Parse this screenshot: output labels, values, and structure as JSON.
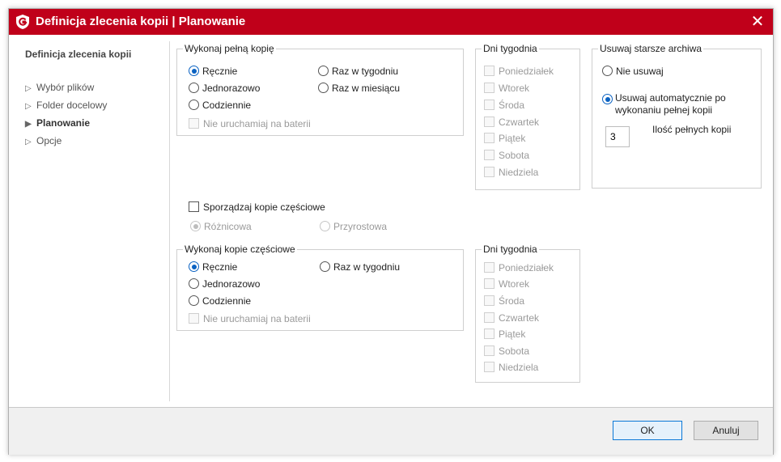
{
  "window": {
    "title": "Definicja zlecenia kopii | Planowanie",
    "accent": "#c0001a"
  },
  "nav": {
    "title": "Definicja zlecenia kopii",
    "items": [
      "Wybór plików",
      "Folder docelowy",
      "Planowanie",
      "Opcje"
    ],
    "active_index": 2
  },
  "full_backup": {
    "legend": "Wykonaj pełną kopię",
    "options": {
      "manual": "Ręcznie",
      "once": "Jednorazowo",
      "daily": "Codziennie",
      "weekly": "Raz w tygodniu",
      "monthly": "Raz w miesiącu"
    },
    "selected": "manual",
    "battery": "Nie uruchamiaj na baterii"
  },
  "weekdays_full": {
    "legend": "Dni tygodnia",
    "days": [
      "Poniedziałek",
      "Wtorek",
      "Środa",
      "Czwartek",
      "Piątek",
      "Sobota",
      "Niedziela"
    ]
  },
  "archives": {
    "legend": "Usuwaj starsze archiwa",
    "option_no": "Nie usuwaj",
    "option_auto": "Usuwaj automatycznie po wykonaniu pełnej kopii",
    "selected": "auto",
    "count_value": "3",
    "count_label": "Ilość pełnych kopii"
  },
  "partial": {
    "checkbox_label": "Sporządzaj kopie częściowe",
    "checked": false,
    "differential": "Różnicowa",
    "incremental": "Przyrostowa",
    "selected": "differential"
  },
  "partial_backup": {
    "legend": "Wykonaj kopie częściowe",
    "options": {
      "manual": "Ręcznie",
      "once": "Jednorazowo",
      "daily": "Codziennie",
      "weekly": "Raz w tygodniu"
    },
    "selected": "manual",
    "battery": "Nie uruchamiaj na baterii"
  },
  "weekdays_partial": {
    "legend": "Dni tygodnia",
    "days": [
      "Poniedziałek",
      "Wtorek",
      "Środa",
      "Czwartek",
      "Piątek",
      "Sobota",
      "Niedziela"
    ]
  },
  "buttons": {
    "ok": "OK",
    "cancel": "Anuluj"
  },
  "icons": {
    "logo": "g-data-shield-icon",
    "close": "close-icon",
    "tree_arrow": "chevron-right-icon"
  }
}
